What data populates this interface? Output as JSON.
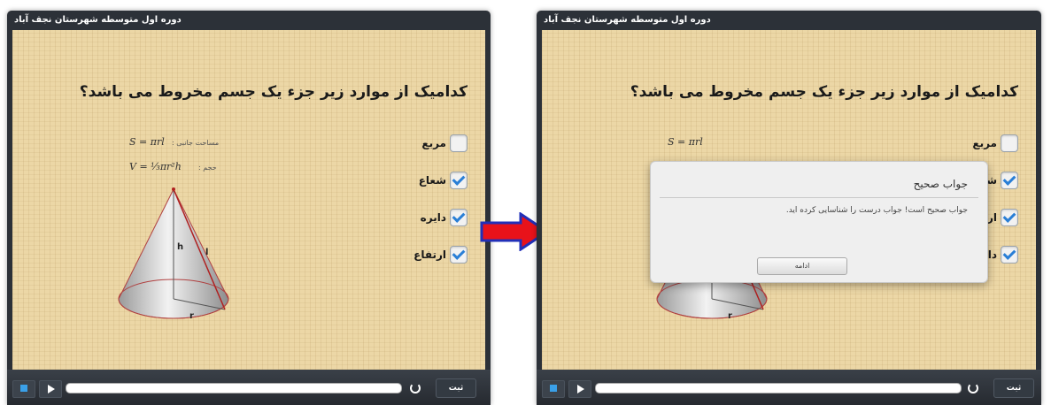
{
  "left_window": {
    "title": "دوره اول متوسطه شهرستان نجف آباد",
    "question": "کدامیک از موارد زیر جزء یک جسم مخروط می باشد؟",
    "options": [
      {
        "label": "مربع",
        "checked": false
      },
      {
        "label": "شعاع",
        "checked": true
      },
      {
        "label": "دایره",
        "checked": true
      },
      {
        "label": "ارتفاع",
        "checked": true
      }
    ],
    "formulas": {
      "area_formula": "S = πrl",
      "area_label": "مساحت جانبی :",
      "volume_formula": "V = ⅓πr²h",
      "volume_label": "حجم :"
    },
    "cone_labels": {
      "h": "h",
      "l": "l",
      "r": "r"
    },
    "submit_label": "ثبت"
  },
  "right_window": {
    "title": "دوره اول متوسطه شهرستان نجف آباد",
    "question": "کدامیک از موارد زیر جزء یک جسم مخروط می باشد؟",
    "options": [
      {
        "label": "مربع",
        "checked": false
      },
      {
        "label": "شعاع",
        "checked": true
      },
      {
        "label": "ارتفاع",
        "checked": true
      },
      {
        "label": "دایره",
        "checked": true
      }
    ],
    "formulas": {
      "area_formula": "S = πrl"
    },
    "cone_labels": {
      "r": "r"
    },
    "dialog": {
      "title": "جواب صحیح",
      "message": "جواب صحیح است! جواب درست را شناسایی کرده اید.",
      "button": "ادامه"
    },
    "submit_label": "ثبت"
  },
  "colors": {
    "window_frame": "#2c3138",
    "stage_bg": "#ecd7a6",
    "check_blue": "#2a7fd6",
    "arrow_red": "#e8121a"
  }
}
